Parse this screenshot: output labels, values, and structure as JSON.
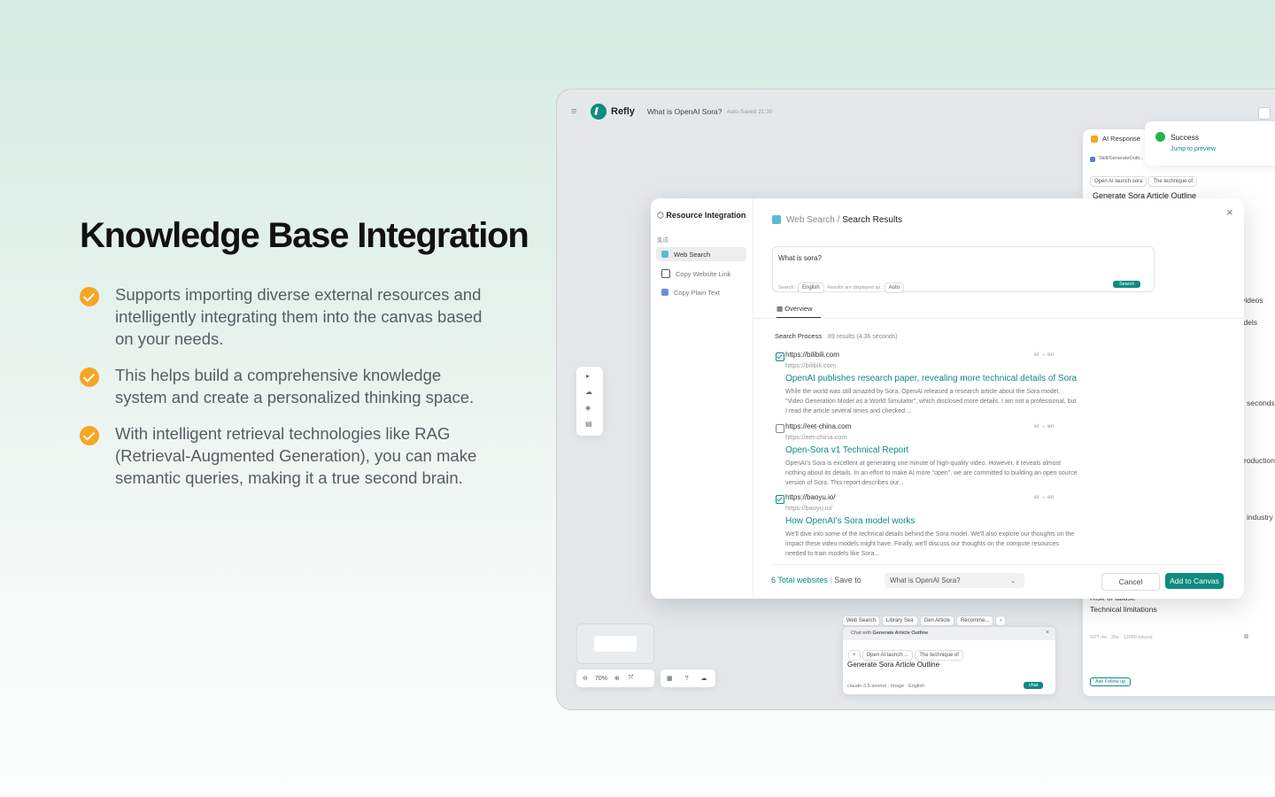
{
  "hero": {
    "title": "Knowledge Base Integration",
    "features": [
      "Supports importing diverse external resources and intelligently integrating them into the canvas based on your needs.",
      "This helps build a comprehensive knowledge system and create a personalized thinking space.",
      "With intelligent retrieval technologies like RAG (Retrieval-Augmented Generation), you can make semantic queries, making it a true second brain."
    ]
  },
  "app": {
    "brand": "Refly",
    "doc_title": "What is OpenAI Sora?",
    "autosave": "Auto-Saved 21:30",
    "ai_response": {
      "label": "AI Response",
      "skill": "Skill/GenerateOutli...",
      "chip1": "Open AI launch sora",
      "chip2": "The technique of",
      "heading": "Generate Sora Article Outline",
      "frag_1": "e",
      "frag_2": "d videos",
      "frag_3": "nodels",
      "frag_4": "seconds",
      "frag_5": "roduction",
      "frag_6": "industry",
      "frag_7": "Risk of abuse",
      "limits": "Technical limitations",
      "footer": "GPT-4o · 30s · 12000 tokens",
      "ask": "Ask Follow up"
    },
    "toast": {
      "title": "Success",
      "link": "Jump to preview"
    },
    "zoom": "70%",
    "chat": {
      "tabs": [
        "Web Search",
        "Library Sea",
        "Gen Article",
        "Recomme..."
      ],
      "header_prefix": "Chat with",
      "header_target": "Generate Article Outline",
      "ctx1": "Open AI launch ...",
      "ctx2": "The technique of",
      "prompt": "Generate Sora Article Outline",
      "model": "claude-3.5-sonnet",
      "image": "Image",
      "lang": "English",
      "send": "chat"
    }
  },
  "modal": {
    "sidebar_title": "Resource Integration",
    "group_label": "集成",
    "items": [
      "Web Search",
      "Copy Website Link",
      "Copy Plain Text"
    ],
    "breadcrumb_parent": "Web Search",
    "breadcrumb_sep": "/",
    "breadcrumb_current": "Search Results",
    "query": "What is sora?",
    "search_label": "Search :",
    "search_lang": "English",
    "display_label": "Results are displayed as :",
    "display_value": "Auto",
    "search_button": "Search",
    "tab": "Overview",
    "process_label": "Search Process",
    "process_stats": "89 results (4.36 seconds)",
    "results": [
      {
        "checked": true,
        "domain": "https://bilibili.com",
        "url": "https://bilibili.com",
        "title": "OpenAI publishes research paper, revealing more technical details of Sora",
        "desc": "While the world was still amazed by Sora, OpenAI released a research article about the Sora model, \"Video Generation Model as a World Simulator\", which disclosed more details. I am not a professional, but I read the article several times and checked ..."
      },
      {
        "checked": false,
        "domain": "https://eet-china.com",
        "url": "https://eet-china.com",
        "title": "Open-Sora v1 Technical Report",
        "desc": "OpenAI's Sora is excellent at generating one minute of high-quality video. However, it reveals almost nothing about its details. In an effort to make AI more \"open\", we are committed to building an open source version of Sora. This report describes our..."
      },
      {
        "checked": true,
        "domain": "https://baoyu.io/",
        "url": "https://baoyu.io/",
        "title": "How OpenAI's Sora model works",
        "desc": "We'll dive into some of the technical details behind the Sora model. We'll also explore our thoughts on the impact these video models might have. Finally, we'll discuss our thoughts on the compute resources needed to train models like Sora..."
      }
    ],
    "result_meta": "el → en",
    "total": "6 Total websites",
    "save_to": "Save to",
    "save_target": "What is  OpenAI Sora?",
    "cancel": "Cancel",
    "add": "Add to Canvas"
  }
}
